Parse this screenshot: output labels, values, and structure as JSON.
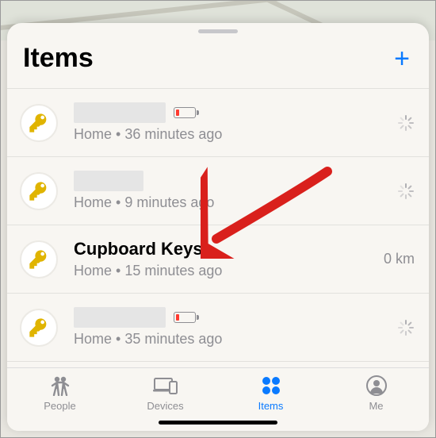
{
  "header": {
    "title": "Items",
    "add_label": "+"
  },
  "items": [
    {
      "title": "",
      "redacted": true,
      "redacted_width": 116,
      "low_battery": true,
      "subtitle": "Home • 36 minutes ago",
      "right_type": "spinner",
      "right_text": ""
    },
    {
      "title": "",
      "redacted": true,
      "redacted_width": 88,
      "low_battery": false,
      "subtitle": "Home • 9 minutes ago",
      "right_type": "spinner",
      "right_text": ""
    },
    {
      "title": "Cupboard Keys",
      "redacted": false,
      "low_battery": false,
      "subtitle": "Home • 15 minutes ago",
      "right_type": "text",
      "right_text": "0 km"
    },
    {
      "title": "",
      "redacted": true,
      "redacted_width": 116,
      "low_battery": true,
      "subtitle": "Home • 35 minutes ago",
      "right_type": "spinner",
      "right_text": ""
    }
  ],
  "tabs": {
    "people": {
      "label": "People",
      "active": false
    },
    "devices": {
      "label": "Devices",
      "active": false
    },
    "items": {
      "label": "Items",
      "active": true
    },
    "me": {
      "label": "Me",
      "active": false
    }
  }
}
